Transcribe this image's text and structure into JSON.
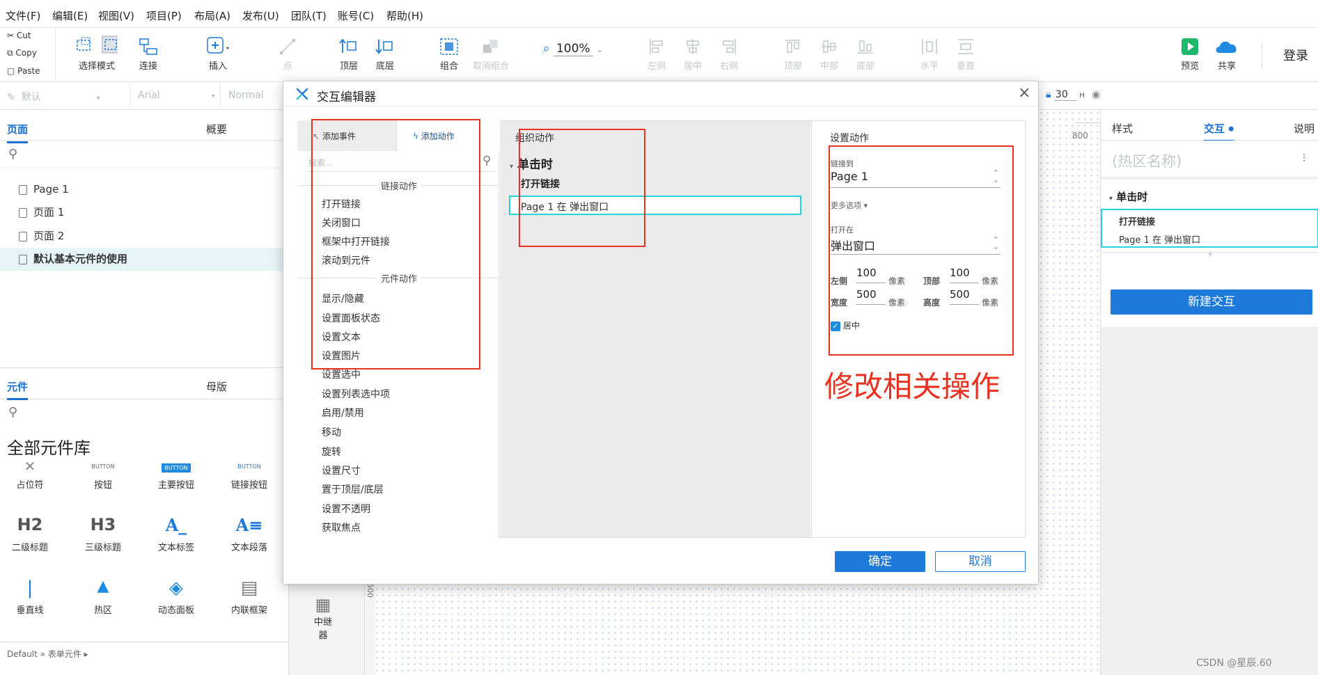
{
  "menu": [
    "文件(F)",
    "编辑(E)",
    "视图(V)",
    "项目(P)",
    "布局(A)",
    "发布(U)",
    "团队(T)",
    "账号(C)",
    "帮助(H)"
  ],
  "clipboard": {
    "cut": "Cut",
    "copy": "Copy",
    "paste": "Paste"
  },
  "toolbar": {
    "select_mode": "选择模式",
    "connect": "连接",
    "insert": "插入",
    "point": "点",
    "top": "顶层",
    "bottom": "底层",
    "group": "组合",
    "ungroup": "取消组合",
    "zoom": "100%",
    "left": "左侧",
    "center": "居中",
    "right": "右侧",
    "top_align": "顶部",
    "middle": "中部",
    "bottom_align": "底部",
    "horizontal": "水平",
    "vertical": "垂直",
    "preview": "预览",
    "share": "共享",
    "login": "登录"
  },
  "format": {
    "style": "默认",
    "font": "Arial",
    "weight": "Normal",
    "h_value": "30",
    "h_label": "H"
  },
  "left_panel": {
    "tab_pages": "页面",
    "tab_outline": "概要",
    "pages": [
      "Page 1",
      "页面 1",
      "页面 2",
      "默认基本元件的使用"
    ],
    "tab_widgets": "元件",
    "tab_masters": "母版",
    "library_title": "全部元件库",
    "widgets": [
      {
        "label": "占位符",
        "glyph": "✕"
      },
      {
        "label": "按钮",
        "glyph": "BUTTON"
      },
      {
        "label": "主要按钮",
        "glyph": "BUTTON"
      },
      {
        "label": "链接按钮",
        "glyph": "BUTTON"
      },
      {
        "label": "二级标题",
        "glyph": "H2"
      },
      {
        "label": "三级标题",
        "glyph": "H3"
      },
      {
        "label": "文本标签",
        "glyph": "A_"
      },
      {
        "label": "文本段落",
        "glyph": "A≡"
      },
      {
        "label": "垂直线",
        "glyph": "|"
      },
      {
        "label": "热区",
        "glyph": "▲"
      },
      {
        "label": "动态面板",
        "glyph": "◈"
      },
      {
        "label": "内联框架",
        "glyph": "▤"
      },
      {
        "label": "中继器",
        "glyph": "▦"
      }
    ],
    "footer": "Default » 表单元件 ▸"
  },
  "canvas": {
    "ruler_800": "800",
    "ruler_500": "500"
  },
  "right_panel": {
    "tab_style": "样式",
    "tab_interact": "交互",
    "tab_notes": "说明",
    "hotspot_name": "(热区名称)",
    "event": "单击时",
    "action": "打开链接",
    "detail": "Page 1 在 弹出窗口",
    "new_button": "新建交互"
  },
  "dialog": {
    "title": "交互编辑器",
    "tab_add_event": "添加事件",
    "tab_add_action": "添加动作",
    "search_placeholder": "搜索...",
    "section_link": "链接动作",
    "link_actions": [
      "打开链接",
      "关闭窗口",
      "框架中打开链接",
      "滚动到元件"
    ],
    "section_widget": "元件动作",
    "widget_actions": [
      "显示/隐藏",
      "设置面板状态",
      "设置文本",
      "设置图片",
      "设置选中",
      "设置列表选中项",
      "启用/禁用",
      "移动",
      "旋转",
      "设置尺寸",
      "置于顶层/底层",
      "设置不透明",
      "获取焦点"
    ],
    "organize_title": "组织动作",
    "event": "单击时",
    "action": "打开链接",
    "action_detail": "Page 1 在 弹出窗口",
    "settings_title": "设置动作",
    "link_to_label": "链接到",
    "link_to_value": "Page 1",
    "more_options": "更多选项 ▾",
    "open_in_label": "打开在",
    "open_in_value": "弹出窗口",
    "left_label": "左侧",
    "left_value": "100",
    "top_label": "顶部",
    "top_value": "100",
    "width_label": "宽度",
    "width_value": "500",
    "height_label": "高度",
    "height_value": "500",
    "unit": "像素",
    "center_label": "居中",
    "annotation": "修改相关操作",
    "ok": "确定",
    "cancel": "取消"
  },
  "watermark": "CSDN @星辰.60",
  "colors": {
    "accent": "#1e7ad8",
    "red": "#e8311f",
    "cyan": "#25d3d8"
  }
}
